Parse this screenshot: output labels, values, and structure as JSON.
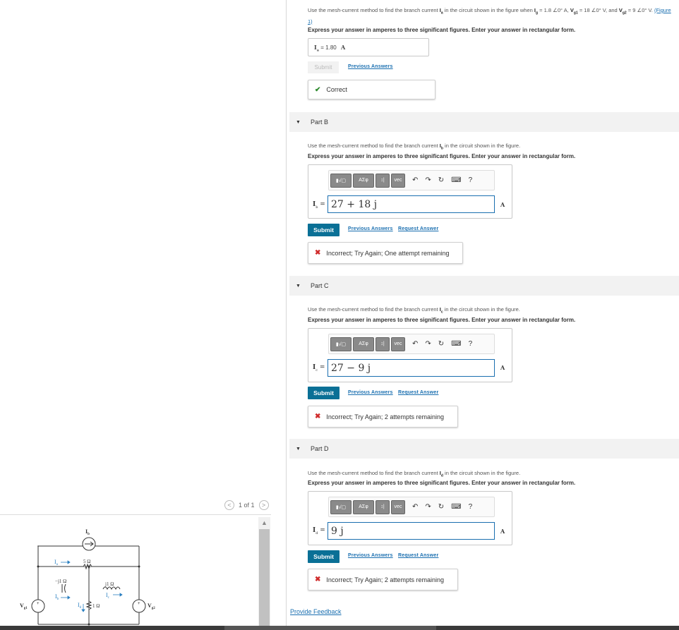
{
  "figure_panel": {
    "pager": {
      "prev": "<",
      "label": "1 of 1",
      "next": ">"
    },
    "circuit_labels": {
      "Ib": "I",
      "Ib_sub": "b",
      "Ia": "I",
      "Ia_sub": "a",
      "R5": "5 Ω",
      "Cneg": "−j1 Ω",
      "Lpos": "j1 Ω",
      "Ib2": "I",
      "Ib2_sub": "b",
      "Ic": "I",
      "Ic_sub": "c",
      "Id": "I",
      "Id_sub": "d",
      "R1": "1 Ω",
      "Vg1": "V",
      "Vg1_sub": "g1",
      "Vg2": "V",
      "Vg2_sub": "g2"
    }
  },
  "partA": {
    "question_1": "Use the mesh-current method to find the branch current",
    "question_var": "I",
    "question_var_sub": "a",
    "question_2": "in the circuit shown in the figure when",
    "cond_1": "I",
    "cond_1_sub": "g",
    "cond_1_val": "= 1.8 ∠0° A,",
    "cond_2": "V",
    "cond_2_sub": "g1",
    "cond_2_val": "= 18 ∠0° V,",
    "cond_and": "and",
    "cond_3": "V",
    "cond_3_sub": "g2",
    "cond_3_val": "= 9 ∠0° V.",
    "figure_link": "(Figure 1)",
    "express": "Express your answer in amperes to three significant figures. Enter your answer in rectangular form.",
    "answer_label": "I",
    "answer_label_sub": "a",
    "answer_eq": "=",
    "answer_value": "1.80",
    "answer_unit": "A",
    "submit": "Submit",
    "previous_answers": "Previous Answers",
    "feedback": "Correct"
  },
  "parts": [
    {
      "title": "Part B",
      "q_pre": "Use the mesh-current method to find the branch current",
      "q_var": "I",
      "q_var_sub": "b",
      "q_post": "in the circuit shown in the figure.",
      "express": "Express your answer in amperes to three significant figures. Enter your answer in rectangular form.",
      "label": "I",
      "label_sub": "b",
      "eq": "=",
      "value": "27 + 18 j",
      "unit": "A",
      "submit": "Submit",
      "previous_answers": "Previous Answers",
      "request_answer": "Request Answer",
      "feedback": "Incorrect; Try Again; One attempt remaining"
    },
    {
      "title": "Part C",
      "q_pre": "Use the mesh-current method to find the branch current",
      "q_var": "I",
      "q_var_sub": "c",
      "q_post": "in the circuit shown in the figure.",
      "express": "Express your answer in amperes to three significant figures. Enter your answer in rectangular form.",
      "label": "I",
      "label_sub": "c",
      "eq": "=",
      "value": "27 − 9 j",
      "unit": "A",
      "submit": "Submit",
      "previous_answers": "Previous Answers",
      "request_answer": "Request Answer",
      "feedback": "Incorrect; Try Again; 2 attempts remaining"
    },
    {
      "title": "Part D",
      "q_pre": "Use the mesh-current method to find the branch current",
      "q_var": "I",
      "q_var_sub": "d",
      "q_post": "in the circuit shown in the figure.",
      "express": "Express your answer in amperes to three significant figures. Enter your answer in rectangular form.",
      "label": "I",
      "label_sub": "d",
      "eq": "=",
      "value": "9 j",
      "unit": "A",
      "submit": "Submit",
      "previous_answers": "Previous Answers",
      "request_answer": "Request Answer",
      "feedback": "Incorrect; Try Again; 2 attempts remaining"
    }
  ],
  "toolbar": {
    "template_label": "▮√▢",
    "greek_label": "ΑΣφ",
    "vec_label": "↕|",
    "vec2_label": "vec",
    "undo": "↶",
    "redo": "↷",
    "reset": "↻",
    "keyboard": "⌨",
    "help": "?"
  },
  "footer": {
    "provide_feedback": "Provide Feedback"
  },
  "colors": {
    "accent": "#0a7096",
    "link": "#1a6fb0",
    "correct": "#2d8a2d",
    "incorrect": "#d02c2c"
  }
}
